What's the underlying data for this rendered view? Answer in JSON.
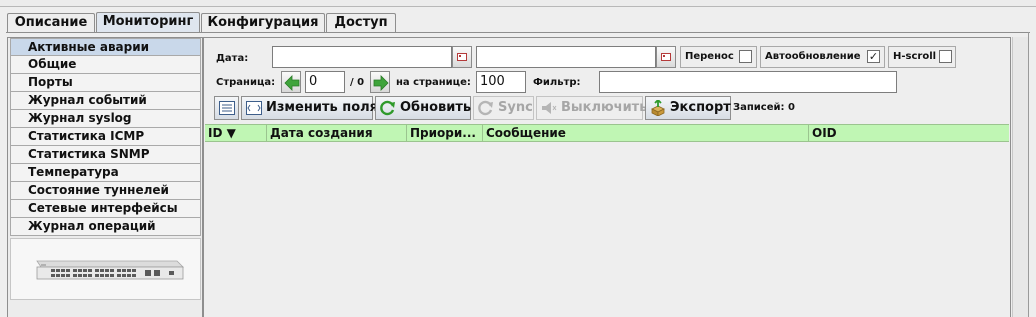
{
  "tabs": [
    {
      "label": "Описание"
    },
    {
      "label": "Мониторинг"
    },
    {
      "label": "Конфигурация"
    },
    {
      "label": "Доступ"
    }
  ],
  "active_tab": "Мониторинг",
  "sidebar": {
    "items": [
      {
        "label": "Активные аварии"
      },
      {
        "label": "Общие"
      },
      {
        "label": "Порты"
      },
      {
        "label": "Журнал событий"
      },
      {
        "label": "Журнал syslog"
      },
      {
        "label": "Статистика ICMP"
      },
      {
        "label": "Статистика SNMP"
      },
      {
        "label": "Температура"
      },
      {
        "label": "Состояние туннелей"
      },
      {
        "label": "Сетевые интерфейсы"
      },
      {
        "label": "Журнал операций"
      }
    ],
    "active_item": "Активные аварии",
    "device_image": "network-switch-image"
  },
  "filters": {
    "date_label": "Дата:",
    "date_from": "",
    "date_to": "",
    "wrap_label": "Перенос",
    "wrap_checked": false,
    "autorefresh_label": "Автообновление",
    "autorefresh_checked": true,
    "autorefresh_mark": "✓",
    "hscroll_label": "H-scroll",
    "hscroll_checked": false,
    "page_label": "Страница:",
    "page_value": "0",
    "page_total": "/ 0",
    "per_page_label": "на странице:",
    "per_page_value": "100",
    "filter_label": "Фильтр:",
    "filter_value": ""
  },
  "toolbar": {
    "columns_icon": "columns-list-icon",
    "edit_fields_label": "Изменить поля",
    "refresh_label": "Обновить",
    "sync_label": "Sync",
    "disable_label": "Выключить",
    "export_label": "Экспорт",
    "records_label": "Записей: 0"
  },
  "table": {
    "columns": [
      {
        "label": "ID ▼"
      },
      {
        "label": "Дата создания"
      },
      {
        "label": "Приори..."
      },
      {
        "label": "Сообщение"
      },
      {
        "label": "OID"
      }
    ],
    "rows": [],
    "header_color": "#c0f6b4"
  }
}
